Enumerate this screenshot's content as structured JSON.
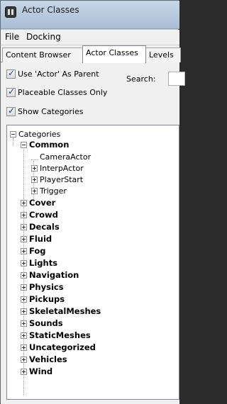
{
  "window": {
    "title": "Actor Classes",
    "icon": "app-icon"
  },
  "menu": {
    "items": [
      "File",
      "Docking"
    ]
  },
  "tabs": [
    "Content Browser",
    "Actor Classes",
    "Levels"
  ],
  "options": {
    "use_actor_as_parent": {
      "label": "Use 'Actor' As Parent",
      "checked": true
    },
    "placeable_only": {
      "label": "Placeable Classes Only",
      "checked": true
    },
    "show_categories": {
      "label": "Show Categories",
      "checked": true
    }
  },
  "search": {
    "label": "Search:",
    "value": ""
  },
  "tree": {
    "root": "Categories",
    "common": {
      "label": "Common",
      "children": [
        "CameraActor",
        "InterpActor",
        "PlayerStart",
        "Trigger"
      ]
    },
    "categories": [
      "Cover",
      "Crowd",
      "Decals",
      "Fluid",
      "Fog",
      "Lights",
      "Navigation",
      "Physics",
      "Pickups",
      "SkeletalMeshes",
      "Sounds",
      "StaticMeshes",
      "Uncategorized",
      "Vehicles",
      "Wind"
    ]
  }
}
